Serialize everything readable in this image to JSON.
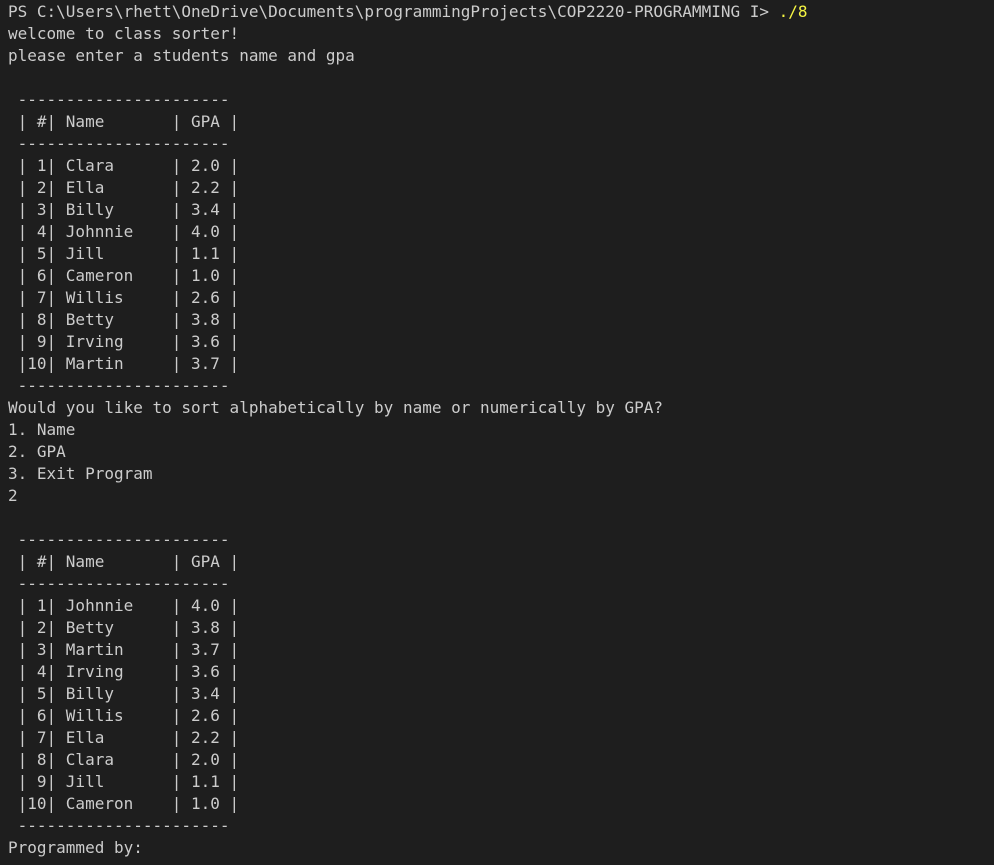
{
  "prompt": {
    "path": "PS C:\\Users\\rhett\\OneDrive\\Documents\\programmingProjects\\COP2220-PROGRAMMING I> ",
    "command": "./8"
  },
  "lines": [
    "welcome to class sorter!",
    "please enter a students name and gpa",
    "",
    " ----------------------",
    " | #| Name       | GPA |",
    " ----------------------",
    " | 1| Clara      | 2.0 |",
    " | 2| Ella       | 2.2 |",
    " | 3| Billy      | 3.4 |",
    " | 4| Johnnie    | 4.0 |",
    " | 5| Jill       | 1.1 |",
    " | 6| Cameron    | 1.0 |",
    " | 7| Willis     | 2.6 |",
    " | 8| Betty      | 3.8 |",
    " | 9| Irving     | 3.6 |",
    " |10| Martin     | 3.7 |",
    " ----------------------",
    "Would you like to sort alphabetically by name or numerically by GPA?",
    "1. Name",
    "2. GPA",
    "3. Exit Program",
    "2",
    "",
    " ----------------------",
    " | #| Name       | GPA |",
    " ----------------------",
    " | 1| Johnnie    | 4.0 |",
    " | 2| Betty      | 3.8 |",
    " | 3| Martin     | 3.7 |",
    " | 4| Irving     | 3.6 |",
    " | 5| Billy      | 3.4 |",
    " | 6| Willis     | 2.6 |",
    " | 7| Ella       | 2.2 |",
    " | 8| Clara      | 2.0 |",
    " | 9| Jill       | 1.1 |",
    " |10| Cameron    | 1.0 |",
    " ----------------------",
    "Programmed by:"
  ],
  "colors": {
    "background": "#1e1e1e",
    "text": "#cccccc",
    "command": "#f5f543"
  }
}
